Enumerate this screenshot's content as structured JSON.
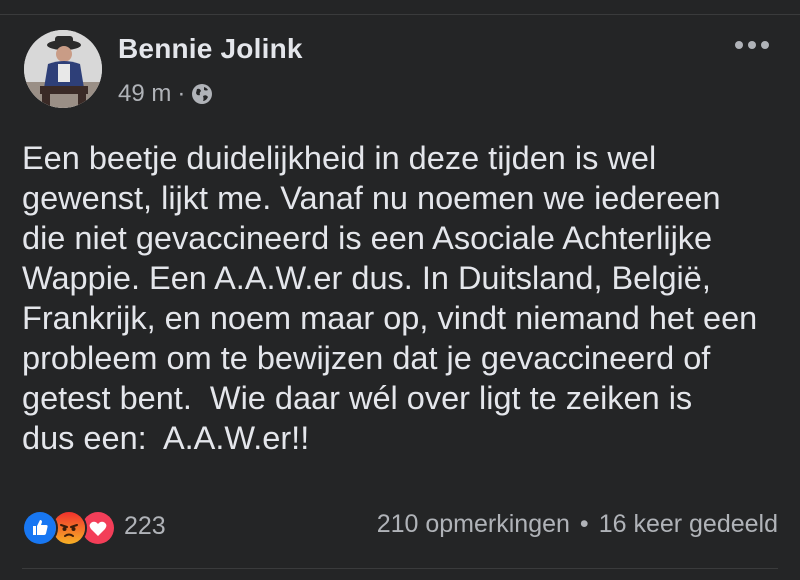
{
  "post": {
    "author": "Bennie Jolink",
    "time": "49 m",
    "meta_separator": "·",
    "privacy_icon": "globe-icon",
    "more_icon": "more-horizontal-icon",
    "text": "Een beetje duidelijkheid in deze tijden is wel\ngewenst, lijkt me. Vanaf nu noemen we iedereen\ndie niet gevaccineerd is een Asociale Achterlijke\nWappie. Een A.A.W.er dus. In Duitsland, België,\nFrankrijk, en noem maar op, vindt niemand het een\nprobleem om te bewijzen dat je gevaccineerd of\ngetest bent.  Wie daar wél over ligt te zeiken is\ndus een:  A.A.W.er!!",
    "reactions": {
      "icons": [
        "like-reaction-icon",
        "angry-reaction-icon",
        "love-reaction-icon"
      ],
      "count": "223"
    },
    "comments": "210 opmerkingen",
    "stats_separator": "•",
    "shares": "16 keer gedeeld"
  },
  "colors": {
    "background": "#242526",
    "text_primary": "#e4e6eb",
    "text_secondary": "#b0b3b8",
    "like_blue": "#1877f2",
    "love_red": "#f33e58",
    "angry_orange": "#e9710f"
  }
}
